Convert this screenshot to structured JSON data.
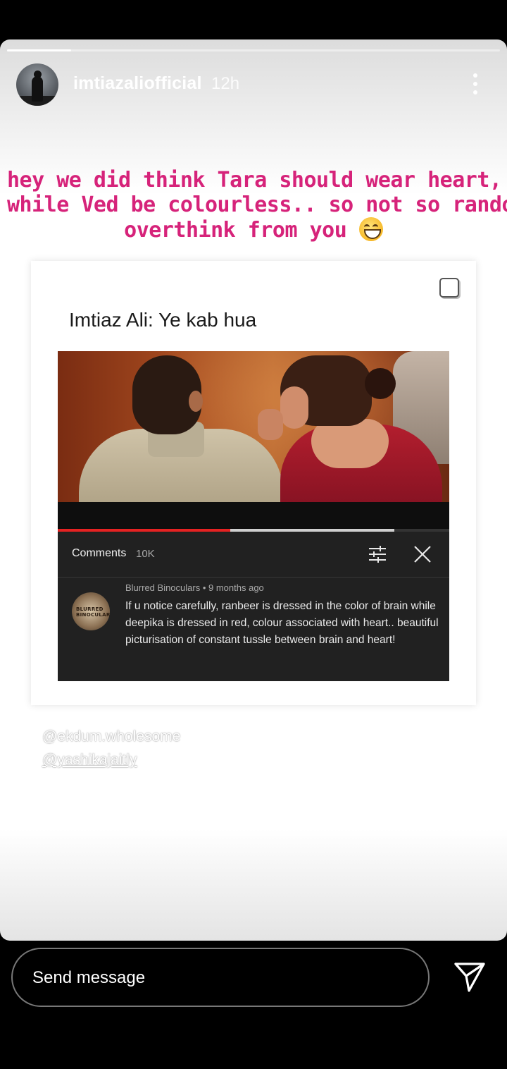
{
  "story": {
    "progress": 0.13,
    "username": "imtiazaliofficial",
    "time": "12h",
    "caption_lines": [
      "hey we did think Tara should wear heart,",
      "while Ved be colourless.. so not so random",
      "overthink from you"
    ],
    "caption_emoji": "grinning-face-with-smiling-eyes",
    "caption_color": "#d6237a"
  },
  "meme": {
    "title": "Imtiaz Ali: Ye kab hua",
    "video": {
      "played_fraction": 0.44,
      "buffered_fraction": 0.86,
      "accent": "#e52222"
    },
    "comments_panel": {
      "label": "Comments",
      "count": "10K",
      "comment": {
        "avatar_text": "BLURRED BINOCULARS",
        "author": "Blurred Binoculars",
        "age": "9 months ago",
        "text": "If u notice carefully, ranbeer is dressed in the color of brain while deepika is dressed in red, colour associated with heart.. beautiful picturisation of constant tussle between brain and heart!"
      }
    }
  },
  "mentions": [
    "@ekdum.wholesome",
    "@yashikajaitly"
  ],
  "footer": {
    "message_placeholder": "Send message"
  }
}
